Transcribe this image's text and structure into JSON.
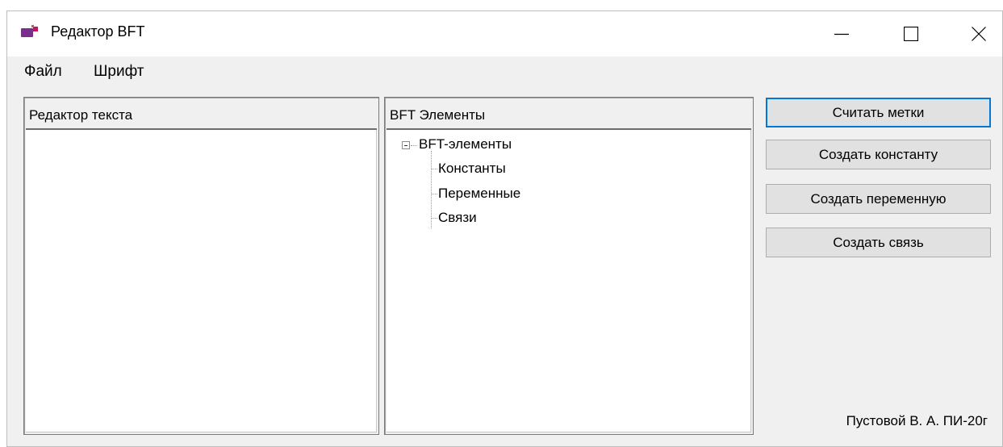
{
  "window": {
    "title": "Редактор BFT",
    "icon": "app-icon",
    "controls": [
      "minimize-icon",
      "maximize-icon",
      "close-icon"
    ]
  },
  "menu": {
    "file": "Файл",
    "font": "Шрифт"
  },
  "text_editor": {
    "header": "Редактор текста",
    "content": ""
  },
  "bft_panel": {
    "header": "BFT Элементы",
    "tree": {
      "root": "BFT-элементы",
      "children": [
        "Константы",
        "Переменные",
        "Связи"
      ]
    }
  },
  "buttons": {
    "read_labels": "Считать метки",
    "create_constant": "Создать константу",
    "create_variable": "Создать переменную",
    "create_link": "Создать связь"
  },
  "author": "Пустовой В. А. ПИ-20г",
  "colors": {
    "accent": "#0078d7",
    "icon": "#7b2d8e"
  }
}
